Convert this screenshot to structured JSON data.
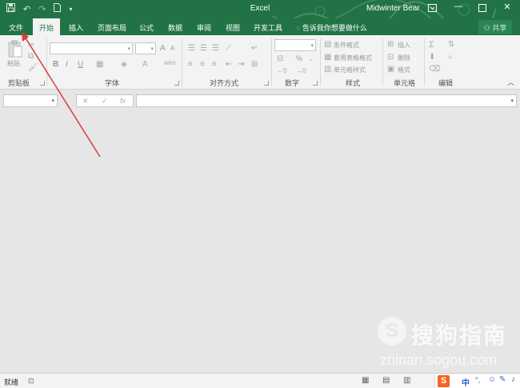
{
  "title_bar": {
    "app_title": "Excel",
    "user_name": "Midwinter Bear",
    "qat_icons": [
      "save-icon",
      "undo-icon",
      "redo-icon",
      "new-file-icon",
      "customize-qat-icon"
    ],
    "window_controls": [
      "ribbon-options-icon",
      "minimize-icon",
      "maximize-icon",
      "close-icon"
    ]
  },
  "tabs": [
    {
      "label": "文件",
      "active": false
    },
    {
      "label": "开始",
      "active": true
    },
    {
      "label": "插入",
      "active": false
    },
    {
      "label": "页面布局",
      "active": false
    },
    {
      "label": "公式",
      "active": false
    },
    {
      "label": "数据",
      "active": false
    },
    {
      "label": "审阅",
      "active": false
    },
    {
      "label": "视图",
      "active": false
    },
    {
      "label": "开发工具",
      "active": false
    }
  ],
  "tell_me": "告诉我你想要做什么",
  "share": "共享",
  "ribbon": {
    "clipboard": {
      "label": "剪贴板",
      "paste": "粘贴"
    },
    "font": {
      "label": "字体",
      "bold": "B",
      "italic": "I",
      "underline": "U",
      "grow": "A",
      "shrink": "A"
    },
    "alignment": {
      "label": "对齐方式"
    },
    "number": {
      "label": "数字",
      "percent": "%",
      "comma": ","
    },
    "styles": {
      "label": "样式",
      "conditional_format": "条件格式",
      "format_as_table": "套用表格格式",
      "cell_styles": "单元格样式"
    },
    "cells": {
      "label": "单元格",
      "insert": "插入",
      "delete": "删除",
      "format": "格式"
    },
    "editing": {
      "label": "编辑"
    }
  },
  "formula_bar": {
    "cancel": "✕",
    "enter": "✓",
    "function": "fx"
  },
  "status": {
    "ready": "就绪"
  },
  "watermark": {
    "brand": "搜狗指南",
    "url": "zhinan.sogou.com",
    "logo_letter": "S"
  },
  "ime": {
    "logo_letter": "S",
    "lang": "中"
  },
  "colors": {
    "accent": "#217346",
    "ribbon_bg": "#f3f3f3",
    "annotation_arrow": "#d93c3c"
  }
}
